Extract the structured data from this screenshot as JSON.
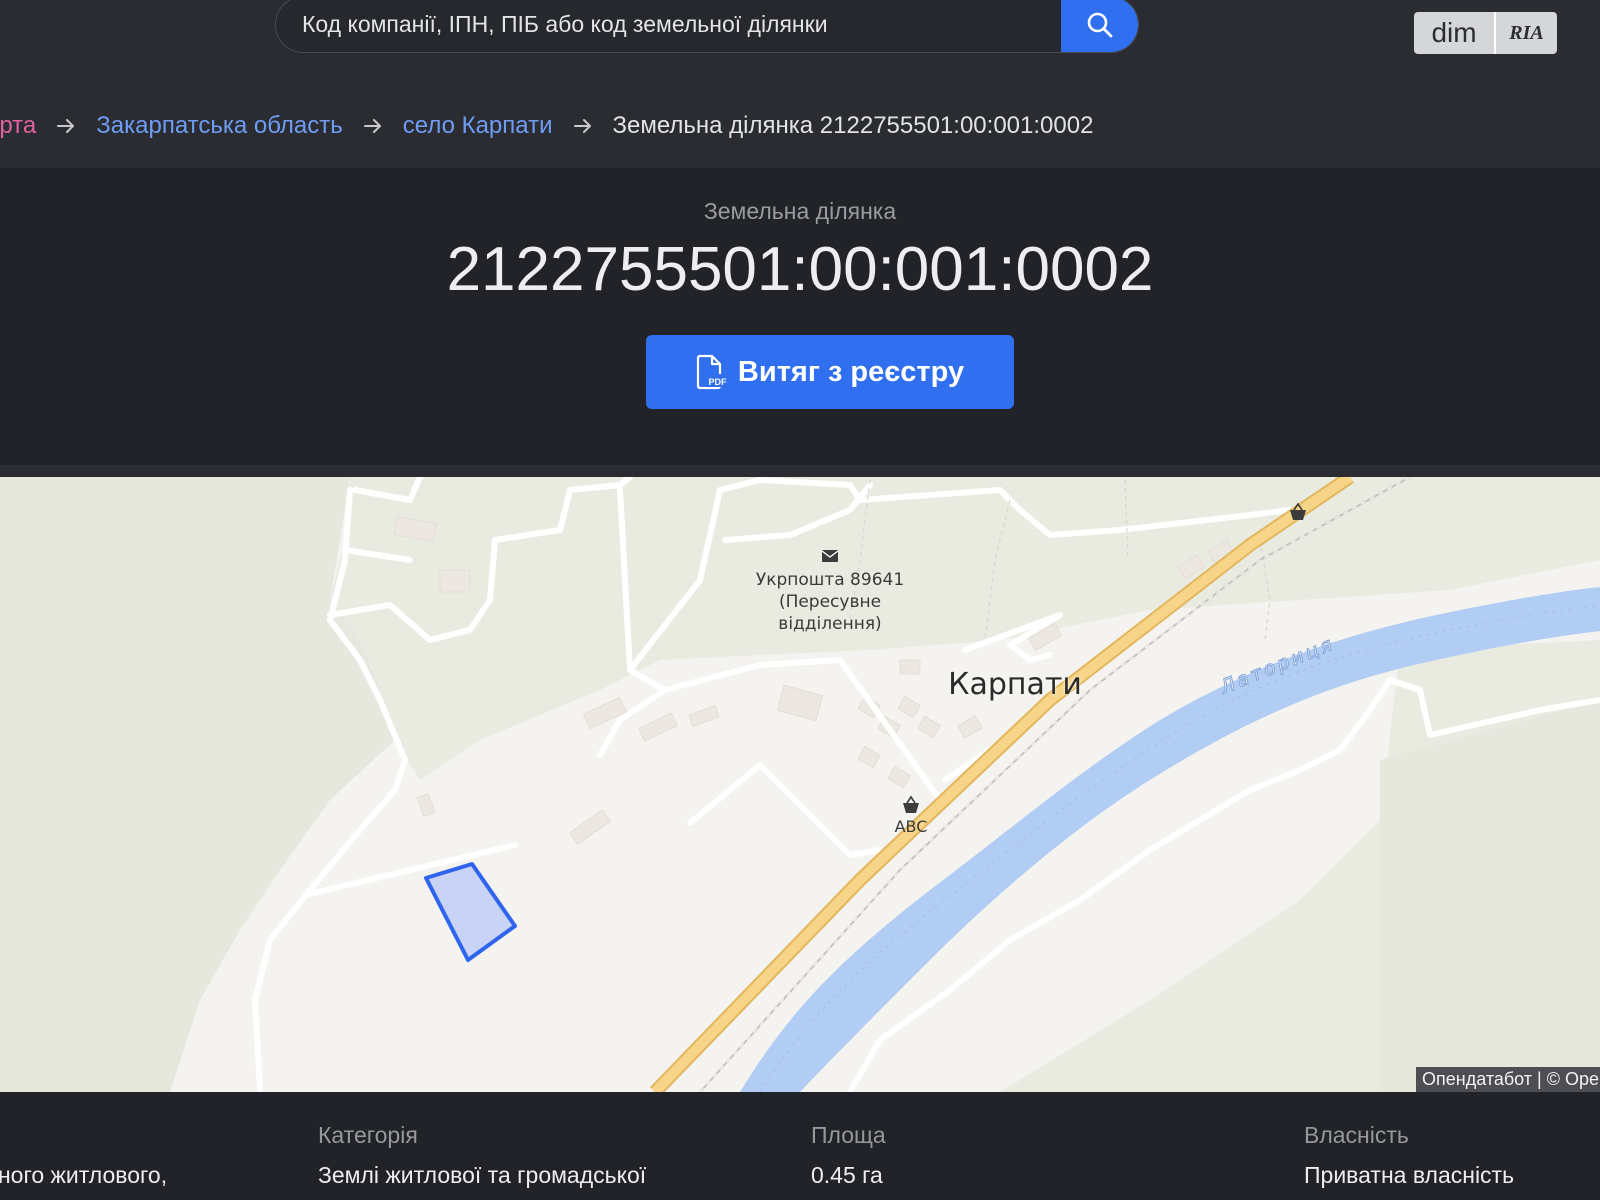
{
  "search": {
    "placeholder": "Код компанії, ІПН, ПІБ або код земельної ділянки"
  },
  "logo": {
    "left": "dim",
    "right": "RIA"
  },
  "breadcrumb": [
    {
      "label": "арта",
      "link": true
    },
    {
      "label": "Закарпатська область",
      "link": true
    },
    {
      "label": "село Карпати",
      "link": true
    },
    {
      "label": "Земельна ділянка 2122755501:00:001:0002",
      "link": false
    }
  ],
  "hero": {
    "subtitle": "Земельна ділянка",
    "title": "2122755501:00:001:0002",
    "pdf_button": "Витяг з реєстру",
    "pdf_icon_text": "PDF"
  },
  "map": {
    "labels": {
      "post_office_line1": "Укрпошта 89641",
      "post_office_line2": "(Пересувне",
      "post_office_line3": "відділення)",
      "village": "Карпати",
      "shop": "ABC",
      "river": "Латориця"
    },
    "attribution": "Опендатабот | © Ope",
    "colors": {
      "parcel_fill": "#c9d3f5",
      "parcel_stroke": "#2f64ee",
      "river": "#b2cdf3",
      "highway": "#f3c76a"
    }
  },
  "info": [
    {
      "label": "",
      "value": "ьного житлового,"
    },
    {
      "label": "Категорія",
      "value": "Землі житлової та громадської"
    },
    {
      "label": "Площа",
      "value": "0.45 га"
    },
    {
      "label": "Власність",
      "value": "Приватна власність"
    }
  ],
  "colors": {
    "accent": "#2f6ff0",
    "link": "#6f9cf4",
    "breadcrumb_first": "#e0629f",
    "background": "#2a2c31",
    "panel": "#212328"
  }
}
